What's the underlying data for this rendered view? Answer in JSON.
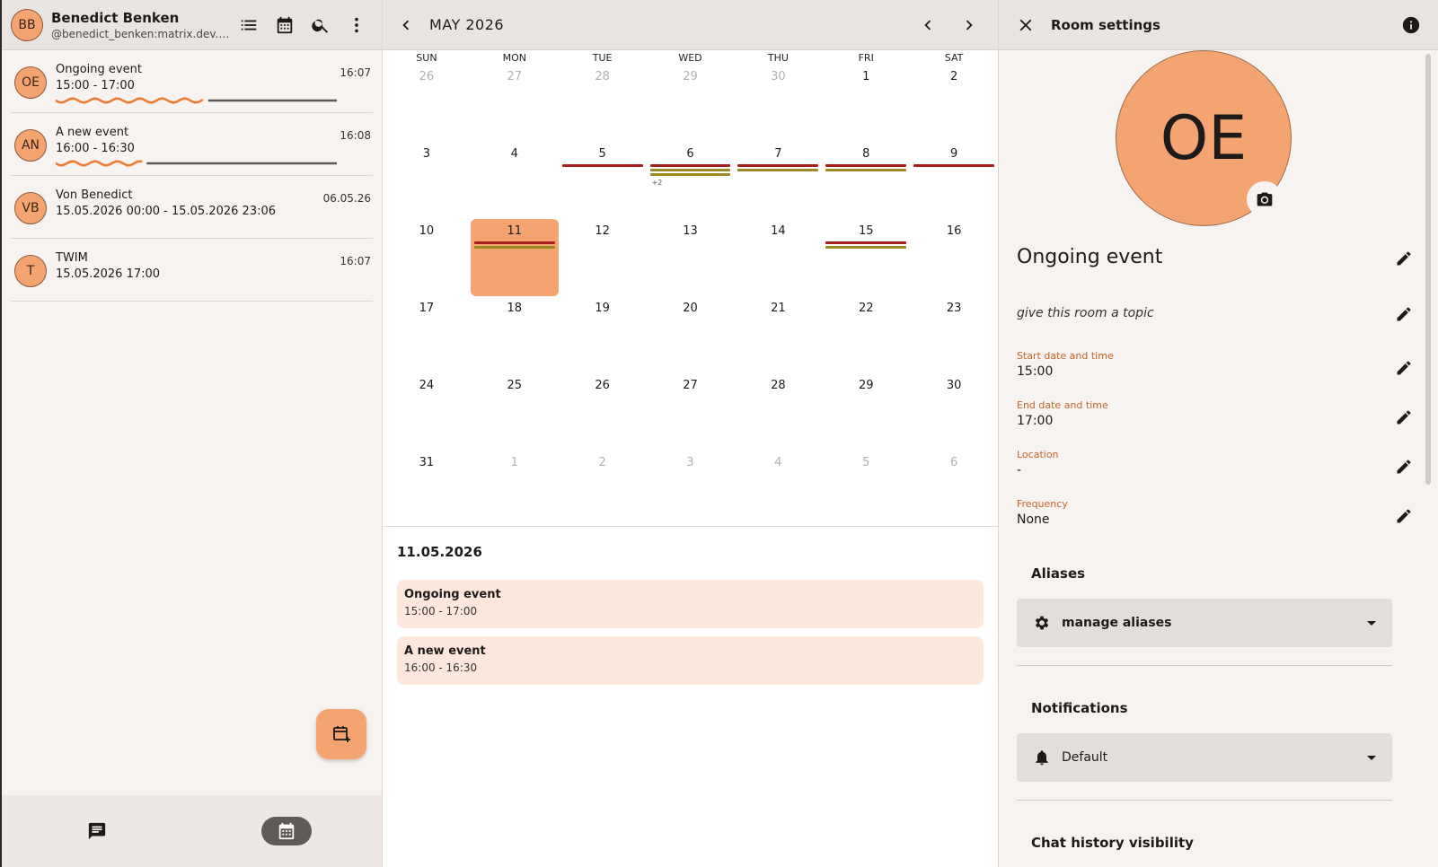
{
  "user": {
    "initials": "BB",
    "name": "Benedict Benken",
    "id": "@benedict_benken:matrix.dev.co.."
  },
  "rooms": [
    {
      "initials": "OE",
      "title": "Ongoing event",
      "subtitle": "15:00 - 17:00",
      "time": "16:07",
      "progress": 0.53
    },
    {
      "initials": "AN",
      "title": "A new event",
      "subtitle": "16:00 - 16:30",
      "time": "16:08",
      "progress": 0.31
    },
    {
      "initials": "VB",
      "title": "Von Benedict",
      "subtitle": "15.05.2026 00:00 - 15.05.2026 23:06",
      "time": "06.05.26"
    },
    {
      "initials": "T",
      "title": "TWIM",
      "subtitle": "15.05.2026 17:00",
      "time": "16:07"
    }
  ],
  "calendar": {
    "month_title": "MAY 2026",
    "weekdays": [
      "SUN",
      "MON",
      "TUE",
      "WED",
      "THU",
      "FRI",
      "SAT"
    ],
    "weeks": [
      [
        {
          "d": "26",
          "o": true
        },
        {
          "d": "27",
          "o": true
        },
        {
          "d": "28",
          "o": true
        },
        {
          "d": "29",
          "o": true
        },
        {
          "d": "30",
          "o": true
        },
        {
          "d": "1"
        },
        {
          "d": "2"
        }
      ],
      [
        {
          "d": "3"
        },
        {
          "d": "4"
        },
        {
          "d": "5"
        },
        {
          "d": "6"
        },
        {
          "d": "7"
        },
        {
          "d": "8"
        },
        {
          "d": "9"
        }
      ],
      [
        {
          "d": "10"
        },
        {
          "d": "11",
          "sel": true
        },
        {
          "d": "12"
        },
        {
          "d": "13"
        },
        {
          "d": "14"
        },
        {
          "d": "15"
        },
        {
          "d": "16"
        }
      ],
      [
        {
          "d": "17"
        },
        {
          "d": "18"
        },
        {
          "d": "19"
        },
        {
          "d": "20"
        },
        {
          "d": "21"
        },
        {
          "d": "22"
        },
        {
          "d": "23"
        }
      ],
      [
        {
          "d": "24"
        },
        {
          "d": "25"
        },
        {
          "d": "26"
        },
        {
          "d": "27"
        },
        {
          "d": "28"
        },
        {
          "d": "29"
        },
        {
          "d": "30"
        }
      ],
      [
        {
          "d": "31"
        },
        {
          "d": "1",
          "o": true
        },
        {
          "d": "2",
          "o": true
        },
        {
          "d": "3",
          "o": true
        },
        {
          "d": "4",
          "o": true
        },
        {
          "d": "5",
          "o": true
        },
        {
          "d": "6",
          "o": true
        }
      ]
    ],
    "event_colors": {
      "red": "#a8201e",
      "olive": "#9a8a22"
    },
    "event_bars": [
      {
        "week": 1,
        "day": 2,
        "color": "red",
        "row": 0
      },
      {
        "week": 1,
        "day": 3,
        "color": "red",
        "row": 0
      },
      {
        "week": 1,
        "day": 3,
        "color": "olive",
        "row": 1
      },
      {
        "week": 1,
        "day": 3,
        "color": "olive",
        "row": 2
      },
      {
        "week": 1,
        "day": 4,
        "color": "red",
        "row": 0
      },
      {
        "week": 1,
        "day": 4,
        "color": "olive",
        "row": 1
      },
      {
        "week": 1,
        "day": 5,
        "color": "red",
        "row": 0
      },
      {
        "week": 1,
        "day": 5,
        "color": "olive",
        "row": 1
      },
      {
        "week": 1,
        "day": 6,
        "color": "red",
        "row": 0
      },
      {
        "week": 2,
        "day": 1,
        "color": "red",
        "row": 0
      },
      {
        "week": 2,
        "day": 1,
        "color": "olive",
        "row": 1
      },
      {
        "week": 2,
        "day": 5,
        "color": "red",
        "row": 0
      },
      {
        "week": 2,
        "day": 5,
        "color": "olive",
        "row": 1
      }
    ],
    "more_label": "+2",
    "selected_date": "11.05.2026",
    "events": [
      {
        "title": "Ongoing event",
        "time": "15:00 - 17:00"
      },
      {
        "title": "A new event",
        "time": "16:00 - 16:30"
      }
    ]
  },
  "settings": {
    "title": "Room settings",
    "avatar_initials": "OE",
    "room_name": "Ongoing event",
    "topic_placeholder": "give this room a topic",
    "start_label": "Start date and time",
    "start_value": "15:00",
    "end_label": "End date and time",
    "end_value": "17:00",
    "location_label": "Location",
    "location_value": "-",
    "frequency_label": "Frequency",
    "frequency_value": "None",
    "aliases_title": "Aliases",
    "aliases_dropdown": "manage aliases",
    "notifications_title": "Notifications",
    "notifications_value": "Default",
    "history_title": "Chat history visibility"
  },
  "colors": {
    "accent": "#f4a470",
    "accent_text": "#c2652a",
    "progress_fill": "#f07b32",
    "progress_track": "#5f5a58"
  }
}
